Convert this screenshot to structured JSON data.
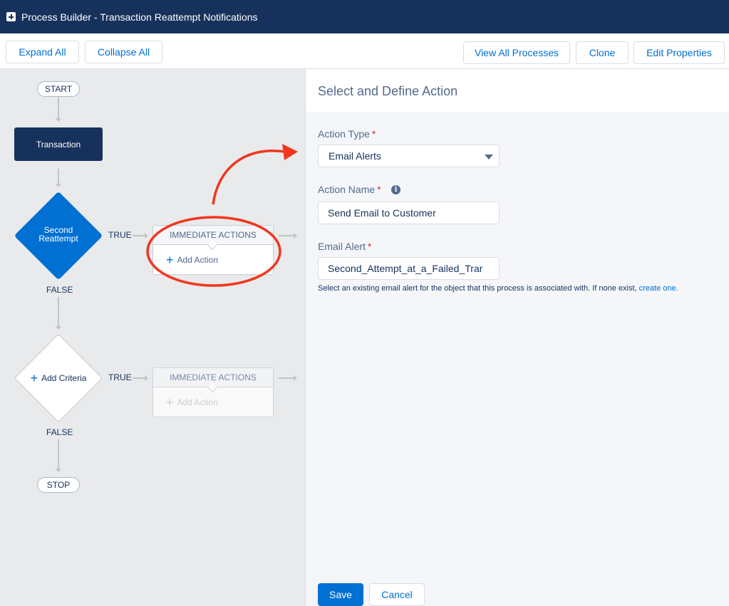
{
  "header": {
    "title": "Process Builder - Transaction Reattempt Notifications"
  },
  "toolbar": {
    "expand_all": "Expand All",
    "collapse_all": "Collapse All",
    "view_all_processes": "View All Processes",
    "clone": "Clone",
    "edit_properties": "Edit Properties"
  },
  "canvas": {
    "start": "START",
    "object_node": "Transaction",
    "criteria1_line1": "Second",
    "criteria1_line2": "Reattempt",
    "true1": "TRUE",
    "false1": "FALSE",
    "actions1_header": "IMMEDIATE ACTIONS",
    "actions1_add": "Add Action",
    "criteria2": "Add Criteria",
    "true2": "TRUE",
    "false2": "FALSE",
    "actions2_header": "IMMEDIATE ACTIONS",
    "actions2_add": "Add Action",
    "stop": "STOP"
  },
  "panel": {
    "title": "Select and Define Action",
    "action_type_label": "Action Type",
    "action_type_value": "Email Alerts",
    "action_name_label": "Action Name",
    "action_name_value": "Send Email to Customer",
    "email_alert_label": "Email Alert",
    "email_alert_value": "Second_Attempt_at_a_Failed_Trar",
    "help_text": "Select an existing email alert for the object that this process is associated with. If none exist, ",
    "help_link": "create one.",
    "required_mark": "*",
    "save": "Save",
    "cancel": "Cancel"
  },
  "colors": {
    "header_bg": "#16325c",
    "brand_blue": "#0070d2",
    "annotation_red": "#f0371f",
    "canvas_bg": "#e9eaec"
  },
  "icons": {
    "app": "plus-square-icon",
    "info": "info-icon",
    "dropdown": "caret-down-icon",
    "add": "plus-icon"
  }
}
